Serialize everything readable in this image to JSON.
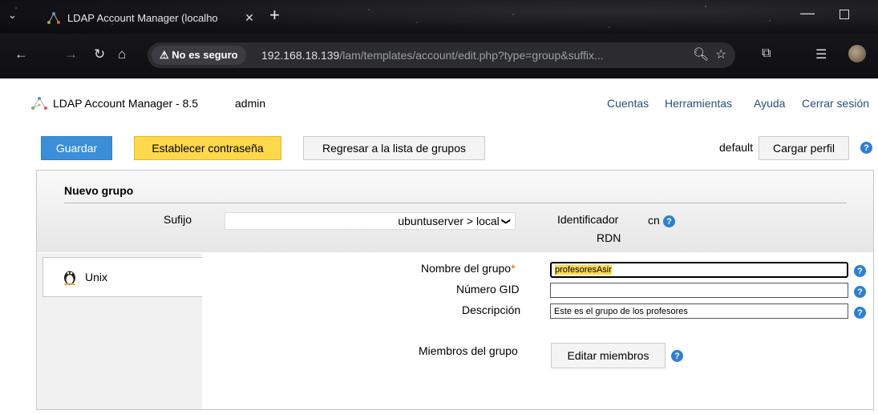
{
  "browser": {
    "tab_title": "LDAP Account Manager (localho",
    "new_tab": "+",
    "security_label": "⚠ No es seguro",
    "url_host": "192.168.18.139",
    "url_path": "/lam/templates/account/edit.php?type=group&suffix..."
  },
  "header": {
    "app_title": "LDAP Account Manager - 8.5",
    "user": "admin",
    "nav": [
      "Cuentas",
      "Herramientas",
      "Ayuda",
      "Cerrar sesión"
    ]
  },
  "actions": {
    "save": "Guardar",
    "set_password": "Establecer contraseña",
    "back": "Regresar a la lista de grupos",
    "profile": "default",
    "load_profile": "Cargar perfil"
  },
  "panel": {
    "title": "Nuevo grupo",
    "suffix_label": "Sufijo",
    "suffix_value": "ubuntuserver > local",
    "rdn_label_1": "Identificador",
    "rdn_label_2": "RDN",
    "rdn_value": "cn"
  },
  "tabs": [
    {
      "label": "Unix"
    }
  ],
  "form": {
    "group_name_label": "Nombre del grupo",
    "group_name_required": "*",
    "group_name_value": "profesoresAsir",
    "gid_label": "Número GID",
    "gid_value": "",
    "description_label": "Descripción",
    "description_value": "Este es el grupo de los profesores",
    "members_label": "Miembros del grupo",
    "members_button": "Editar miembros"
  },
  "help_glyph": "?",
  "colors": {
    "save_button": "#3a8fd8",
    "password_button": "#ffd84d",
    "help_icon": "#2d7fd3",
    "nav_link": "#2c4f7e"
  }
}
